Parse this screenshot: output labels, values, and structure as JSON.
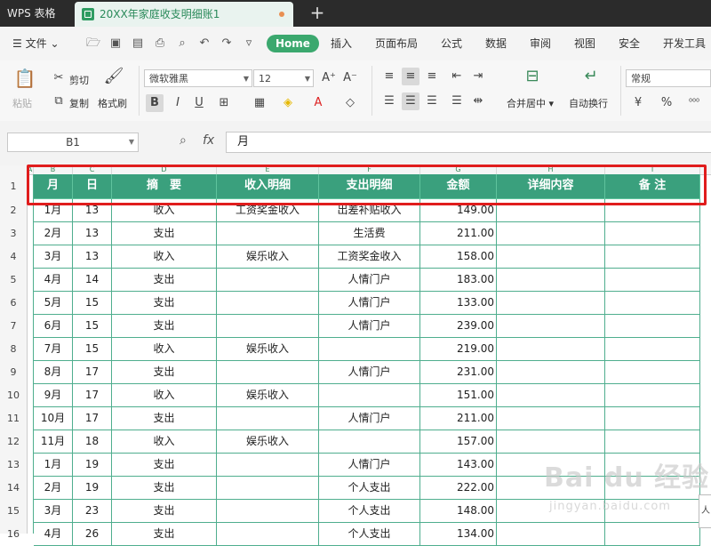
{
  "titlebar": {
    "app_label": "WPS 表格",
    "doc_tab": "20XX年家庭收支明细账1",
    "new_tab": "+"
  },
  "menubar": {
    "file_label": "文件",
    "tabs": [
      "Home",
      "插入",
      "页面布局",
      "公式",
      "数据",
      "审阅",
      "视图",
      "安全",
      "开发工具"
    ],
    "active_tab": "Home"
  },
  "ribbon": {
    "paste": "粘贴",
    "cut": "剪切",
    "copy": "复制",
    "format_painter": "格式刷",
    "font_name": "微软雅黑",
    "font_size": "12",
    "bold": "B",
    "italic": "I",
    "underline": "U",
    "merge_center": "合并居中",
    "wrap_text": "自动换行",
    "number_format": "常规"
  },
  "formula_bar": {
    "name_box": "B1",
    "fx": "fx",
    "content": "月"
  },
  "columns": [
    "A",
    "B",
    "C",
    "D",
    "E",
    "F",
    "G",
    "H",
    "I"
  ],
  "row_numbers": [
    "1",
    "2",
    "3",
    "4",
    "5",
    "6",
    "7",
    "8",
    "9",
    "10",
    "11",
    "12",
    "13",
    "14",
    "15",
    "16"
  ],
  "table": {
    "headers": [
      "月",
      "日",
      "摘　要",
      "收入明细",
      "支出明细",
      "金额",
      "详细内容",
      "备 注"
    ],
    "rows": [
      [
        "1月",
        "13",
        "收入",
        "工资奖金收入",
        "出差补贴收入",
        "149.00",
        "",
        ""
      ],
      [
        "2月",
        "13",
        "支出",
        "",
        "生活费",
        "211.00",
        "",
        ""
      ],
      [
        "3月",
        "13",
        "收入",
        "娱乐收入",
        "工资奖金收入",
        "158.00",
        "",
        ""
      ],
      [
        "4月",
        "14",
        "支出",
        "",
        "人情门户",
        "183.00",
        "",
        ""
      ],
      [
        "5月",
        "15",
        "支出",
        "",
        "人情门户",
        "133.00",
        "",
        ""
      ],
      [
        "6月",
        "15",
        "支出",
        "",
        "人情门户",
        "239.00",
        "",
        ""
      ],
      [
        "7月",
        "15",
        "收入",
        "娱乐收入",
        "",
        "219.00",
        "",
        ""
      ],
      [
        "8月",
        "17",
        "支出",
        "",
        "人情门户",
        "231.00",
        "",
        ""
      ],
      [
        "9月",
        "17",
        "收入",
        "娱乐收入",
        "",
        "151.00",
        "",
        ""
      ],
      [
        "10月",
        "17",
        "支出",
        "",
        "人情门户",
        "211.00",
        "",
        ""
      ],
      [
        "11月",
        "18",
        "收入",
        "娱乐收入",
        "",
        "157.00",
        "",
        ""
      ],
      [
        "1月",
        "19",
        "支出",
        "",
        "人情门户",
        "143.00",
        "",
        ""
      ],
      [
        "2月",
        "19",
        "支出",
        "",
        "个人支出",
        "222.00",
        "",
        ""
      ],
      [
        "3月",
        "23",
        "支出",
        "",
        "个人支出",
        "148.00",
        "",
        ""
      ],
      [
        "4月",
        "26",
        "支出",
        "",
        "个人支出",
        "134.00",
        "",
        ""
      ]
    ]
  },
  "watermark": {
    "line1": "Bai du 经验",
    "line2": "jingyan.baidu.com"
  },
  "edge_tip": "人"
}
